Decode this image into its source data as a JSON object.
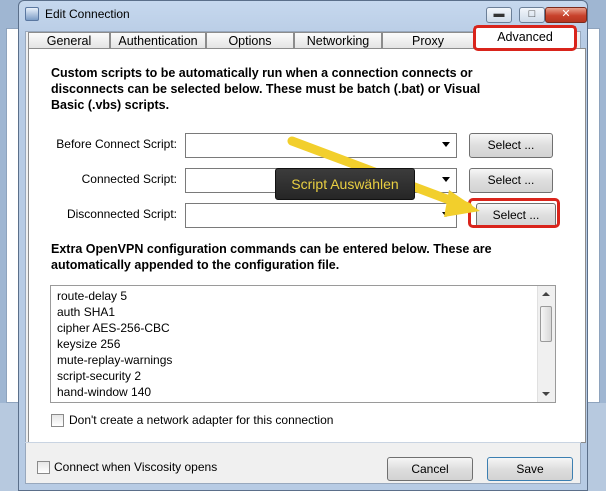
{
  "dialog": {
    "title": "Edit Connection",
    "min_glyph": "▬",
    "max_glyph": "□",
    "close_glyph": "✕"
  },
  "tabs": [
    {
      "label": "General"
    },
    {
      "label": "Authentication"
    },
    {
      "label": "Options"
    },
    {
      "label": "Networking"
    },
    {
      "label": "Proxy"
    },
    {
      "label": "Advanced"
    }
  ],
  "active_tab": "Advanced",
  "scripts": {
    "intro_line1": "Custom scripts to be automatically run when a connection connects or",
    "intro_line2": "disconnects can be selected below. These must be batch (.bat) or Visual",
    "intro_line3": "Basic (.vbs) scripts.",
    "before_connect_label": "Before Connect Script:",
    "connected_label": "Connected Script:",
    "disconnected_label": "Disconnected Script:",
    "select_label": "Select ..."
  },
  "openvpn": {
    "intro_line1": "Extra OpenVPN configuration commands can be entered below. These are",
    "intro_line2": "automatically appended to the configuration file.",
    "lines": [
      "route-delay 5",
      "auth SHA1",
      "cipher AES-256-CBC",
      "keysize 256",
      "mute-replay-warnings",
      "script-security 2",
      "hand-window 140"
    ]
  },
  "no_adapter_checkbox": {
    "label": "Don't create a network adapter for this connection",
    "checked": false
  },
  "footer": {
    "connect_on_open_label": "Connect when Viscosity opens",
    "connect_on_open_checked": false,
    "cancel_label": "Cancel",
    "save_label": "Save"
  },
  "annotation": {
    "tooltip_text": "Script Auswählen",
    "highlight_color": "#d9241b",
    "arrow_color": "#f2cf2c"
  }
}
